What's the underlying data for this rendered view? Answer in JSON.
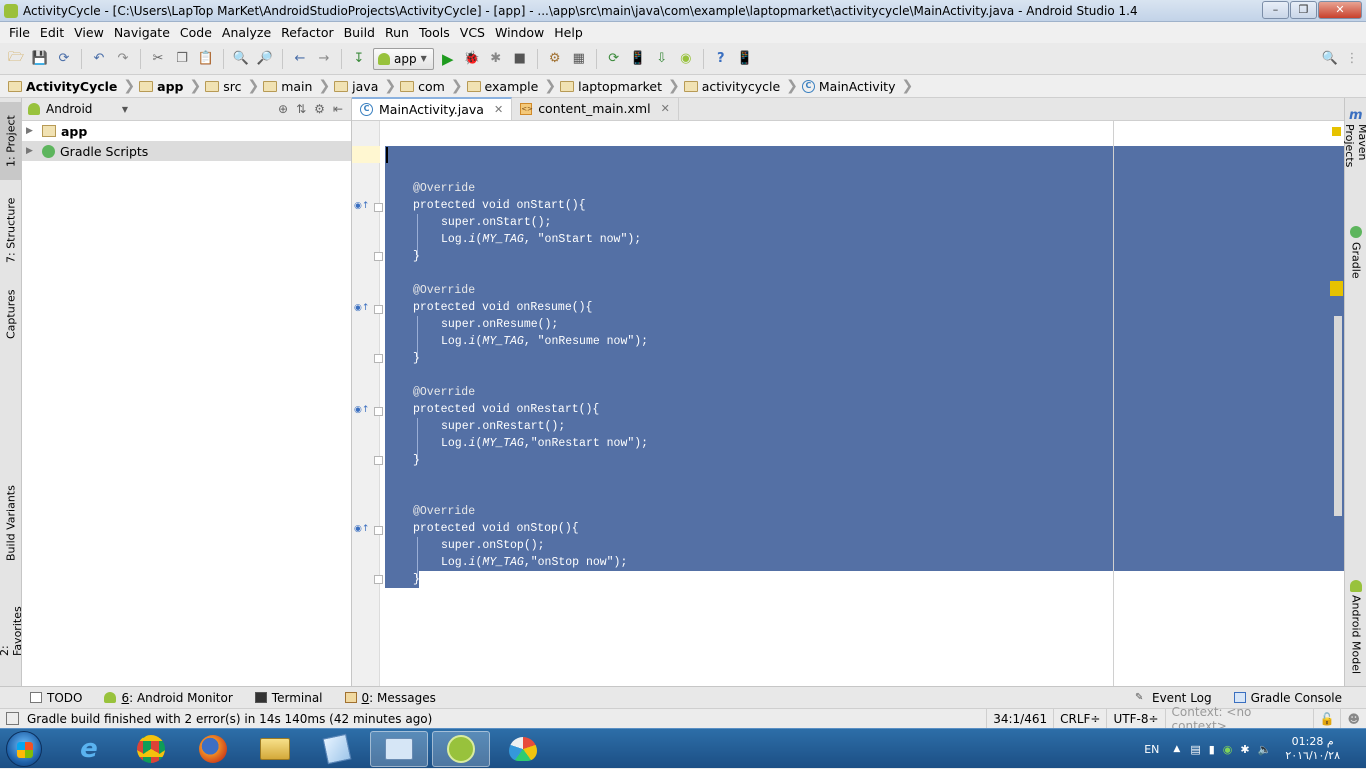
{
  "window": {
    "title": "ActivityCycle - [C:\\Users\\LapTop MarKet\\AndroidStudioProjects\\ActivityCycle] - [app] - ...\\app\\src\\main\\java\\com\\example\\laptopmarket\\activitycycle\\MainActivity.java - Android Studio 1.4"
  },
  "menu": [
    "File",
    "Edit",
    "View",
    "Navigate",
    "Code",
    "Analyze",
    "Refactor",
    "Build",
    "Run",
    "Tools",
    "VCS",
    "Window",
    "Help"
  ],
  "toolbar": {
    "run_config": "app"
  },
  "breadcrumb": [
    "ActivityCycle",
    "app",
    "src",
    "main",
    "java",
    "com",
    "example",
    "laptopmarket",
    "activitycycle",
    "MainActivity"
  ],
  "left_tabs": {
    "project": "1: Project",
    "structure": "7: Structure",
    "captures": "Captures",
    "build_variants": "Build Variants",
    "favorites": "2: Favorites"
  },
  "right_tabs": {
    "maven": "Maven Projects",
    "gradle": "Gradle",
    "android_model": "Android Model"
  },
  "project_panel": {
    "view": "Android",
    "tree": [
      {
        "label": "app",
        "bold": true
      },
      {
        "label": "Gradle Scripts",
        "bold": false
      }
    ]
  },
  "editor_tabs": [
    {
      "label": "MainActivity.java",
      "active": true
    },
    {
      "label": "content_main.xml",
      "active": false
    }
  ],
  "code": {
    "blocks": [
      {
        "annotation": "@Override",
        "signature": "protected void onStart(){",
        "call": "super.onStart();",
        "log_pre": "Log.",
        "log_i": "i",
        "log_tag": "MY_TAG",
        "log_msg": ", \"onStart now\");",
        "close": "}"
      },
      {
        "annotation": "@Override",
        "signature": "protected void onResume(){",
        "call": "super.onResume();",
        "log_pre": "Log.",
        "log_i": "i",
        "log_tag": "MY_TAG",
        "log_msg": ", \"onResume now\");",
        "close": "}"
      },
      {
        "annotation": "@Override",
        "signature": "protected void onRestart(){",
        "call": "super.onRestart();",
        "log_pre": "Log.",
        "log_i": "i",
        "log_tag": "MY_TAG",
        "log_msg": ",\"onRestart now\");",
        "close": "}"
      },
      {
        "annotation": "@Override",
        "signature": "protected void onStop(){",
        "call": "super.onStop();",
        "log_pre": "Log.",
        "log_i": "i",
        "log_tag": "MY_TAG",
        "log_msg": ",\"onStop now\");",
        "close": "}"
      }
    ]
  },
  "bottom_tools": [
    {
      "prefix": "",
      "label": "TODO"
    },
    {
      "prefix": "6",
      "label": ": Android Monitor"
    },
    {
      "prefix": "",
      "label": "Terminal"
    },
    {
      "prefix": "0",
      "label": ": Messages"
    }
  ],
  "bottom_right_tools": [
    "Event Log",
    "Gradle Console"
  ],
  "status": {
    "message": "Gradle build finished with 2 error(s) in 14s 140ms (42 minutes ago)",
    "position": "34:1/461",
    "line_sep": "CRLF÷",
    "encoding": "UTF-8÷",
    "context": "Context: <no context>"
  },
  "taskbar": {
    "lang": "EN",
    "time": "01:28 م",
    "date": "٢٠١٦/١٠/٢٨"
  },
  "colors": {
    "selection": "#5470a5",
    "accent": "#98c23c",
    "taskbar": "#1c4f85"
  }
}
